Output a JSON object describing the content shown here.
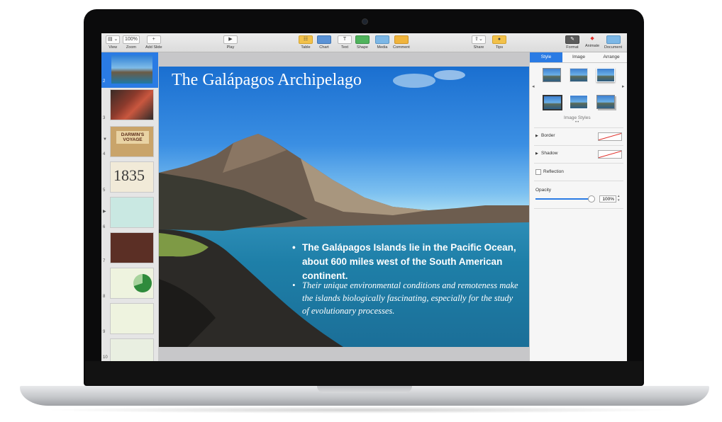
{
  "toolbar": {
    "view": {
      "icon": "view-icon",
      "label": "View"
    },
    "zoom": {
      "value": "100%",
      "label": "Zoom"
    },
    "add_slide": {
      "icon": "plus-icon",
      "label": "Add Slide"
    },
    "play": {
      "icon": "play-icon",
      "label": "Play"
    },
    "table": {
      "icon": "table-icon",
      "label": "Table"
    },
    "chart": {
      "icon": "chart-icon",
      "label": "Chart"
    },
    "text": {
      "icon": "text-icon",
      "glyph": "T",
      "label": "Text"
    },
    "shape": {
      "icon": "shape-icon",
      "label": "Shape"
    },
    "media": {
      "icon": "media-icon",
      "label": "Media"
    },
    "comment": {
      "icon": "comment-icon",
      "label": "Comment"
    },
    "share": {
      "icon": "share-icon",
      "label": "Share"
    },
    "tips": {
      "icon": "tips-icon",
      "label": "Tips"
    },
    "format": {
      "icon": "format-brush-icon",
      "label": "Format"
    },
    "animate": {
      "icon": "animate-icon",
      "label": "Animate"
    },
    "document": {
      "icon": "document-icon",
      "label": "Document"
    }
  },
  "navigator": {
    "slides": [
      {
        "number": "2",
        "selected": true
      },
      {
        "number": "3"
      },
      {
        "number": "4",
        "thumb_text": "DARWIN'S VOYAGE"
      },
      {
        "number": "5",
        "thumb_text": "1835"
      },
      {
        "number": "6"
      },
      {
        "number": "7"
      },
      {
        "number": "8"
      },
      {
        "number": "9"
      },
      {
        "number": "10"
      }
    ]
  },
  "slide": {
    "title": "The Galápagos Archipelago",
    "bullet_1": "The Galápagos Islands lie in the Pacific Ocean, about 600 miles west of the South American continent.",
    "bullet_2": "Their unique environmental conditions and remoteness make the islands biologically fascinating, especially for the study of evolutionary processes."
  },
  "inspector": {
    "tabs": [
      "Style",
      "Image",
      "Arrange"
    ],
    "active_tab": "Style",
    "image_styles_label": "Image Styles",
    "border_label": "Border",
    "shadow_label": "Shadow",
    "reflection_label": "Reflection",
    "opacity_label": "Opacity",
    "opacity_value": "100%",
    "opacity_level": 1.0
  },
  "colors": {
    "accent": "#2a7be4",
    "swatch_line": "#e0302a"
  }
}
